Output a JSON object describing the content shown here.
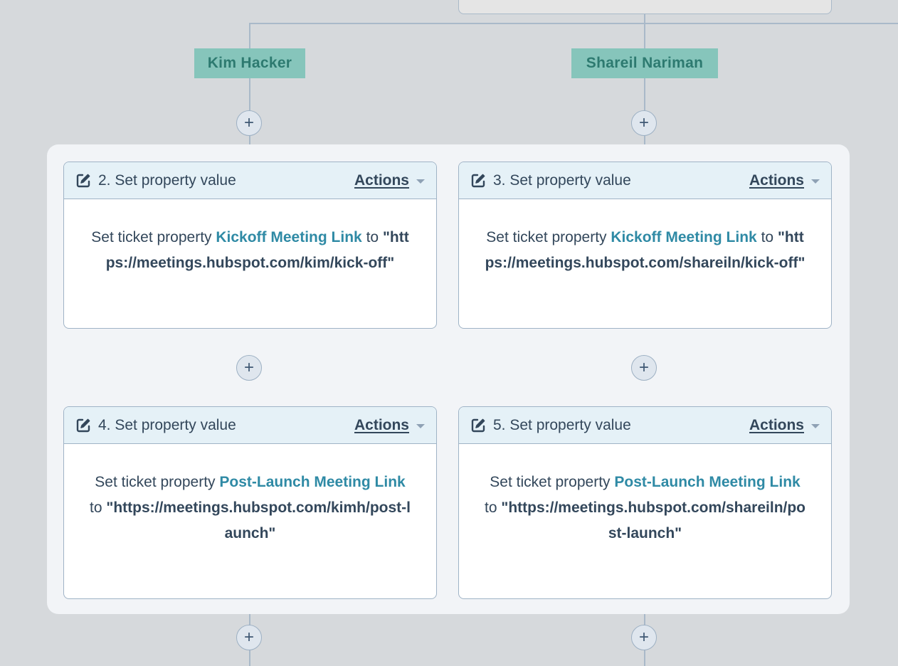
{
  "branches": [
    {
      "label": "Kim Hacker"
    },
    {
      "label": "Shareil Nariman"
    }
  ],
  "add_action_symbol": "+",
  "icons": {
    "edit": "edit-square-pencil-icon",
    "dropdown": "caret-down-icon",
    "add": "plus-icon"
  },
  "colors": {
    "canvas": "#d6d9dc",
    "branch_label_bg": "#86c5bb",
    "branch_label_text": "#2d7a70",
    "card_header_bg": "#e5f1f7",
    "link": "#2f8aa5",
    "connector": "#a9b9c9"
  },
  "cards": [
    {
      "title": "2. Set property value",
      "actions_label": "Actions",
      "prefix": "Set ticket property",
      "property": "Kickoff Meeting Link",
      "connector": "to",
      "value": "\"https://meetings.hubspot.com/kim/kick-off\""
    },
    {
      "title": "3. Set property value",
      "actions_label": "Actions",
      "prefix": "Set ticket property",
      "property": "Kickoff Meeting Link",
      "connector": "to",
      "value": "\"https://meetings.hubspot.com/shareiln/kick-off\""
    },
    {
      "title": "4. Set property value",
      "actions_label": "Actions",
      "prefix": "Set ticket property",
      "property": "Post-Launch Meeting Link",
      "connector": "to",
      "value": "\"https://meetings.hubspot.com/kimh/post-launch\""
    },
    {
      "title": "5. Set property value",
      "actions_label": "Actions",
      "prefix": "Set ticket property",
      "property": "Post-Launch Meeting Link",
      "connector": "to",
      "value": "\"https://meetings.hubspot.com/shareiln/post-launch\""
    }
  ]
}
